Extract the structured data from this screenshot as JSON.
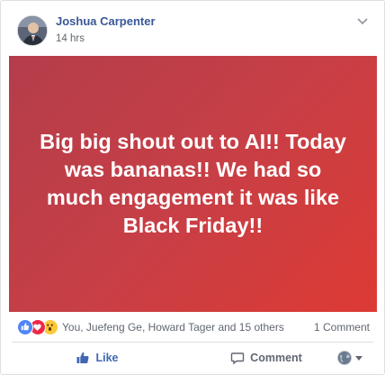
{
  "post": {
    "author": "Joshua Carpenter",
    "timestamp": "14 hrs",
    "text": "Big big shout out to AI!! Today was bananas!! We had so much engagement it was like Black Friday!!",
    "background_gradient": [
      "#b43d4b",
      "#dd3a34"
    ]
  },
  "reactions": {
    "icons": [
      "like-icon",
      "love-icon",
      "wow-icon"
    ],
    "summary": "You, Juefeng Ge, Howard Tager and 15 others",
    "comment_count": "1 Comment"
  },
  "actions": {
    "like_label": "Like",
    "comment_label": "Comment"
  },
  "colors": {
    "link": "#385898",
    "like_active": "#4267b2",
    "muted": "#606770"
  }
}
